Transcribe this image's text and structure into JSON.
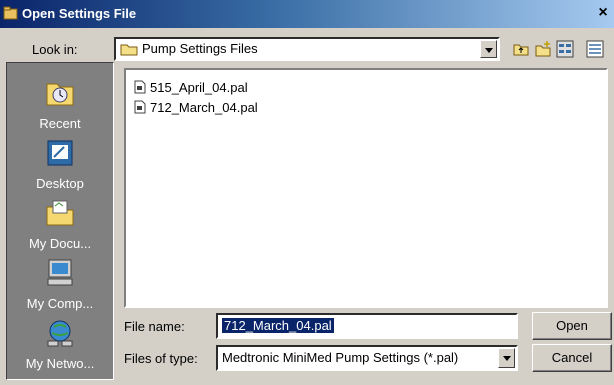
{
  "window": {
    "title": "Open Settings File",
    "close_glyph": "×"
  },
  "lookin": {
    "label": "Look in:",
    "value": "Pump Settings Files"
  },
  "places": [
    {
      "label": "Recent",
      "icon": "recent-icon"
    },
    {
      "label": "Desktop",
      "icon": "desktop-icon"
    },
    {
      "label": "My Docu...",
      "icon": "my-documents-icon"
    },
    {
      "label": "My Comp...",
      "icon": "my-computer-icon"
    },
    {
      "label": "My Netwo...",
      "icon": "my-network-icon"
    }
  ],
  "files": [
    {
      "name": "515_April_04.pal"
    },
    {
      "name": "712_March_04.pal"
    }
  ],
  "filename": {
    "label": "File name:",
    "value": "712_March_04.pal"
  },
  "filetype": {
    "label": "Files of type:",
    "value": "Medtronic MiniMed Pump Settings (*.pal)"
  },
  "buttons": {
    "open": "Open",
    "cancel": "Cancel"
  },
  "colors": {
    "title_start": "#0a246a",
    "title_end": "#a6caf0",
    "face": "#d4d0c8",
    "places_bg": "#808080",
    "selection": "#0a246a"
  }
}
